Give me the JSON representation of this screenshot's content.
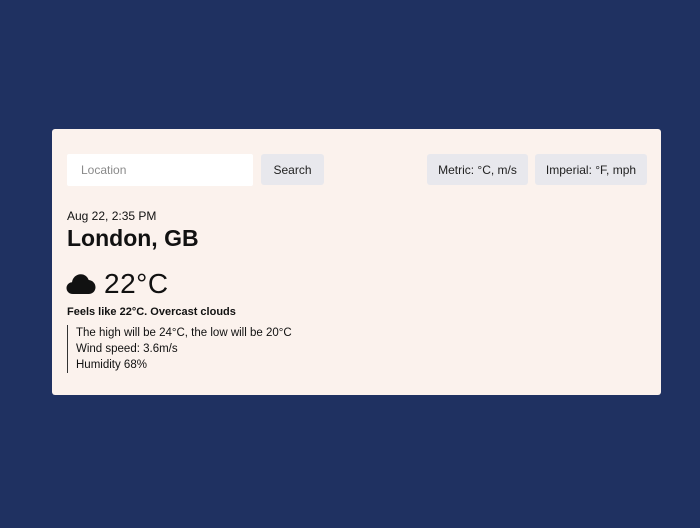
{
  "search": {
    "placeholder": "Location",
    "value": "",
    "button_label": "Search"
  },
  "units": {
    "metric_label": "Metric: °C, m/s",
    "imperial_label": "Imperial: °F, mph"
  },
  "weather": {
    "datetime": "Aug 22, 2:35 PM",
    "city": "London, GB",
    "icon": "cloud-icon",
    "temperature": "22°C",
    "summary": "Feels like 22°C. Overcast clouds",
    "high_low": "The high will be 24°C, the low will be 20°C",
    "wind": "Wind speed: 3.6m/s",
    "humidity": "Humidity 68%"
  },
  "colors": {
    "background": "#1f3161",
    "card": "#fbf2ed",
    "button": "#e8e8ed",
    "text": "#111111"
  }
}
